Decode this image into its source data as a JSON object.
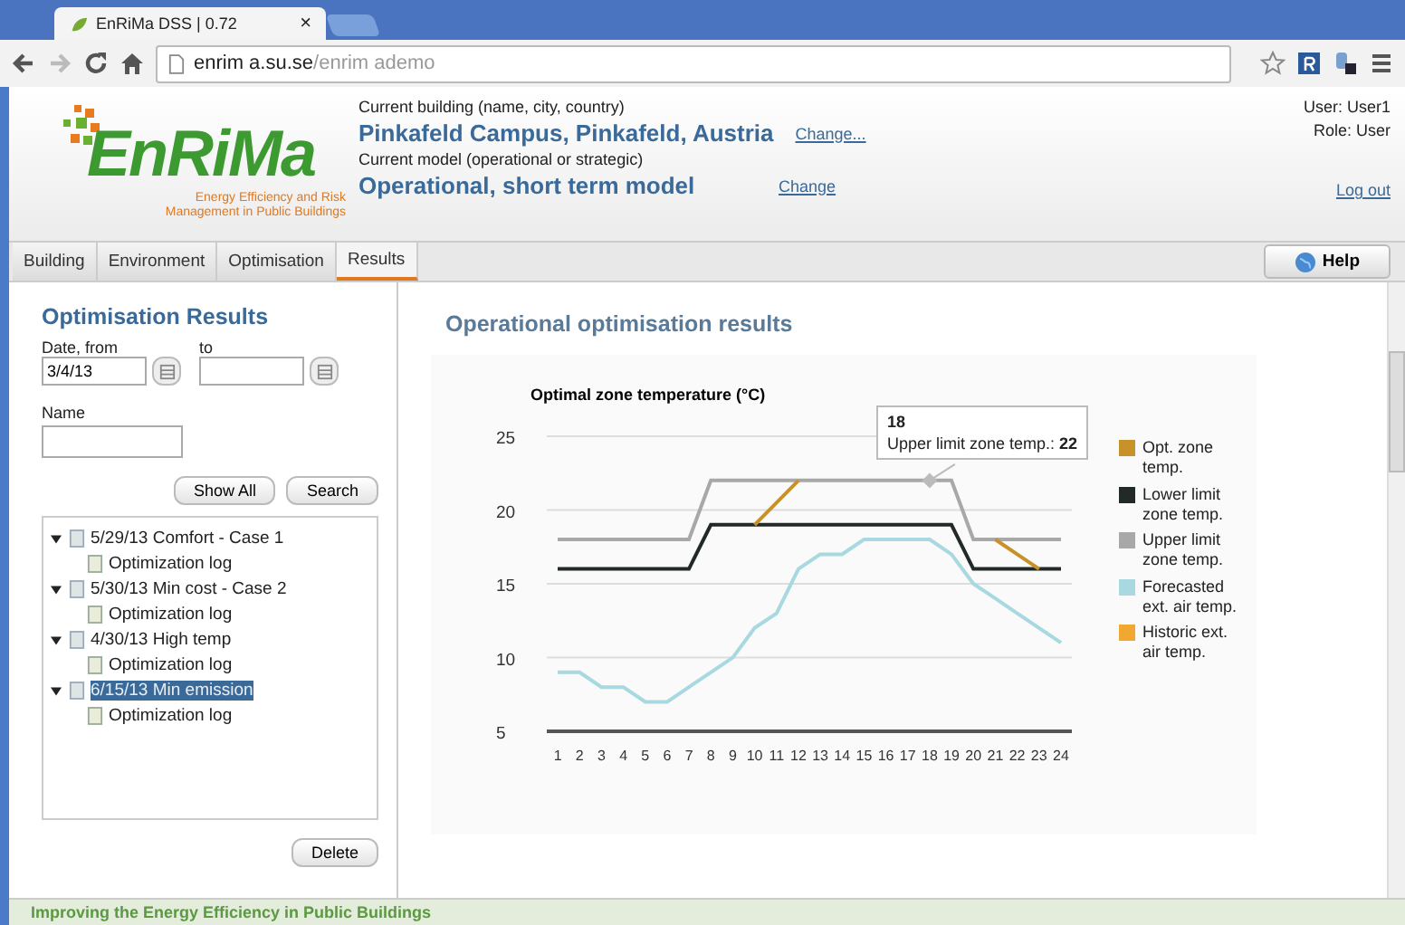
{
  "browser": {
    "tab_title": "EnRiMa DSS | 0.72",
    "tab_close": "×",
    "url_host": "enrim a.su.se",
    "url_path": "/enrim ademo"
  },
  "header": {
    "logo": "EnRiMa",
    "logo_subtitle": "Energy Efficiency and Risk Management in Public Buildings",
    "building_label": "Current building (name, city, country)",
    "building_value": "Pinkafeld Campus, Pinkafeld, Austria",
    "building_change": "Change...",
    "model_label": "Current model (operational or strategic)",
    "model_value": "Operational, short term model",
    "model_change": "Change",
    "user": "User: User1",
    "role": "Role: User",
    "logout": "Log out"
  },
  "tabs": [
    {
      "label": "Building",
      "selected": false
    },
    {
      "label": "Environment",
      "selected": false
    },
    {
      "label": "Optimisation",
      "selected": false
    },
    {
      "label": "Results",
      "selected": true
    }
  ],
  "help": "Help",
  "sidebar": {
    "title": "Optimisation Results",
    "date_from_label": "Date, from",
    "date_from": "3/4/13",
    "date_to_label": "to",
    "name_label": "Name",
    "show_all": "Show All",
    "search": "Search",
    "delete": "Delete",
    "tree": [
      {
        "label": "5/29/13 Comfort - Case 1",
        "expanded": true,
        "selected": false,
        "children": [
          {
            "label": "Optimization log"
          }
        ]
      },
      {
        "label": "5/30/13 Min cost - Case 2",
        "expanded": true,
        "selected": false,
        "children": [
          {
            "label": "Optimization log"
          }
        ]
      },
      {
        "label": "4/30/13 High temp",
        "expanded": true,
        "selected": false,
        "children": [
          {
            "label": "Optimization log"
          }
        ]
      },
      {
        "label": "6/15/13 Min emission",
        "expanded": true,
        "selected": true,
        "children": [
          {
            "label": "Optimization log"
          }
        ]
      }
    ]
  },
  "main": {
    "title": "Operational optimisation results",
    "tooltip": {
      "title": "18",
      "text": "Upper limit zone temp.: **22**"
    },
    "chart_data": {
      "type": "line",
      "title": "Optimal zone temperature (°C)",
      "xlim": [
        0.5,
        24.5
      ],
      "grid": true,
      "x": [
        1,
        2,
        3,
        4,
        5,
        6,
        7,
        8,
        9,
        10,
        11,
        12,
        13,
        14,
        15,
        16,
        17,
        18,
        19,
        20,
        21,
        22,
        23,
        24
      ],
      "ylim": [
        5,
        25
      ],
      "yticks": [
        5,
        10,
        15,
        20,
        25
      ],
      "xticks": [
        1,
        2,
        3,
        4,
        5,
        6,
        7,
        8,
        9,
        10,
        11,
        12,
        13,
        14,
        15,
        16,
        17,
        18,
        19,
        20,
        21,
        22,
        23,
        24
      ],
      "series": [
        {
          "name": "Opt. zone temp.",
          "color": "#c8922a",
          "values": [
            null,
            null,
            null,
            null,
            null,
            null,
            null,
            null,
            null,
            19,
            20.5,
            22,
            null,
            null,
            null,
            null,
            null,
            null,
            null,
            null,
            18,
            17,
            16,
            null
          ]
        },
        {
          "name": "Lower limit zone temp.",
          "color": "#222a28",
          "values": [
            16,
            16,
            16,
            16,
            16,
            16,
            16,
            19,
            19,
            19,
            19,
            19,
            19,
            19,
            19,
            19,
            19,
            19,
            19,
            16,
            16,
            16,
            16,
            16
          ]
        },
        {
          "name": "Upper limit zone temp.",
          "color": "#a8a8a8",
          "values": [
            18,
            18,
            18,
            18,
            18,
            18,
            18,
            22,
            22,
            22,
            22,
            22,
            22,
            22,
            22,
            22,
            22,
            22,
            22,
            18,
            18,
            18,
            18,
            18
          ]
        },
        {
          "name": "Forecasted ext. air temp.",
          "color": "#a8d8e0",
          "values": [
            9,
            9,
            8,
            8,
            7,
            7,
            8,
            9,
            10,
            12,
            13,
            16,
            17,
            17,
            18,
            18,
            18,
            18,
            17,
            15,
            14,
            13,
            12,
            11
          ]
        },
        {
          "name": "Historic ext. air temp.",
          "color": "#f0a830",
          "values": [
            null,
            null,
            null,
            null,
            null,
            null,
            null,
            null,
            null,
            null,
            null,
            null,
            null,
            null,
            null,
            null,
            null,
            null,
            null,
            null,
            null,
            null,
            null,
            null
          ]
        }
      ]
    }
  },
  "footer": "Improving the Energy Efficiency in Public Buildings"
}
